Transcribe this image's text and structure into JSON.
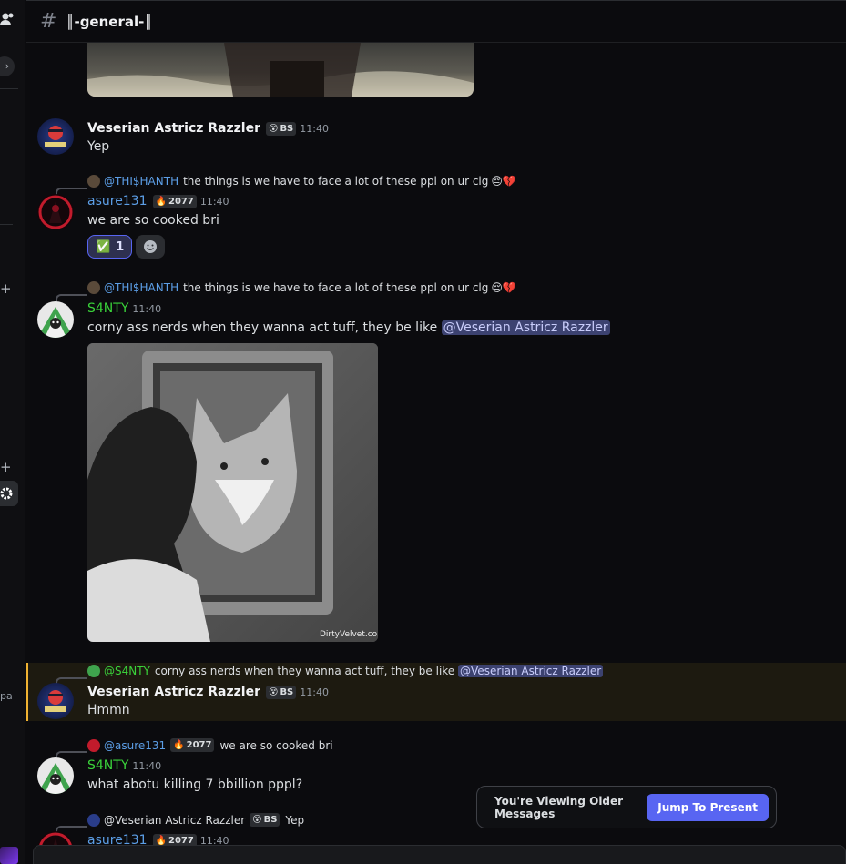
{
  "channel": {
    "title": "║-general-║"
  },
  "sidebar": {
    "pa_text": "pa"
  },
  "messages": {
    "m1": {
      "author": "Veserian Astricz Razzler",
      "badge": "BS",
      "time": "11:40",
      "text": "Yep",
      "color": "#f2f3f5"
    },
    "m2": {
      "reply_name": "@THI$HANTH",
      "reply_text": "the things is we have to face a lot of these ppl on ur clg",
      "author": "asure131",
      "badge": "2077",
      "time": "11:40",
      "text": "we are so cooked bri",
      "color": "#5c9ee6",
      "reaction_emoji": "✅",
      "reaction_count": "1"
    },
    "m3": {
      "reply_name": "@THI$HANTH",
      "reply_text": "the things is we have to face a lot of these ppl on ur clg",
      "author": "S4NTY",
      "time": "11:40",
      "text": "corny ass nerds when they wanna act tuff, they be like",
      "mention": "@Veserian Astricz Razzler",
      "color": "#3ad33a",
      "image_caption": "DirtyVelvet.co.uk"
    },
    "m4": {
      "reply_name": "@S4NTY",
      "reply_text": "corny ass nerds when they wanna act tuff, they be like",
      "reply_mention": "@Veserian Astricz Razzler",
      "author": "Veserian Astricz Razzler",
      "badge": "BS",
      "time": "11:40",
      "text": "Hmmn",
      "color": "#f2f3f5"
    },
    "m5": {
      "reply_name": "@asure131",
      "reply_badge": "2077",
      "reply_text": "we are so cooked bri",
      "author": "S4NTY",
      "time": "11:40",
      "text": "what abotu killing 7 bbillion pppl?",
      "color": "#3ad33a"
    },
    "m6": {
      "reply_name": "@Veserian Astricz Razzler",
      "reply_badge": "BS",
      "reply_text": "Yep",
      "author": "asure131",
      "badge": "2077",
      "time": "11:40",
      "color": "#5c9ee6"
    }
  },
  "toast": {
    "text": "You're Viewing Older Messages",
    "button": "Jump To Present"
  }
}
